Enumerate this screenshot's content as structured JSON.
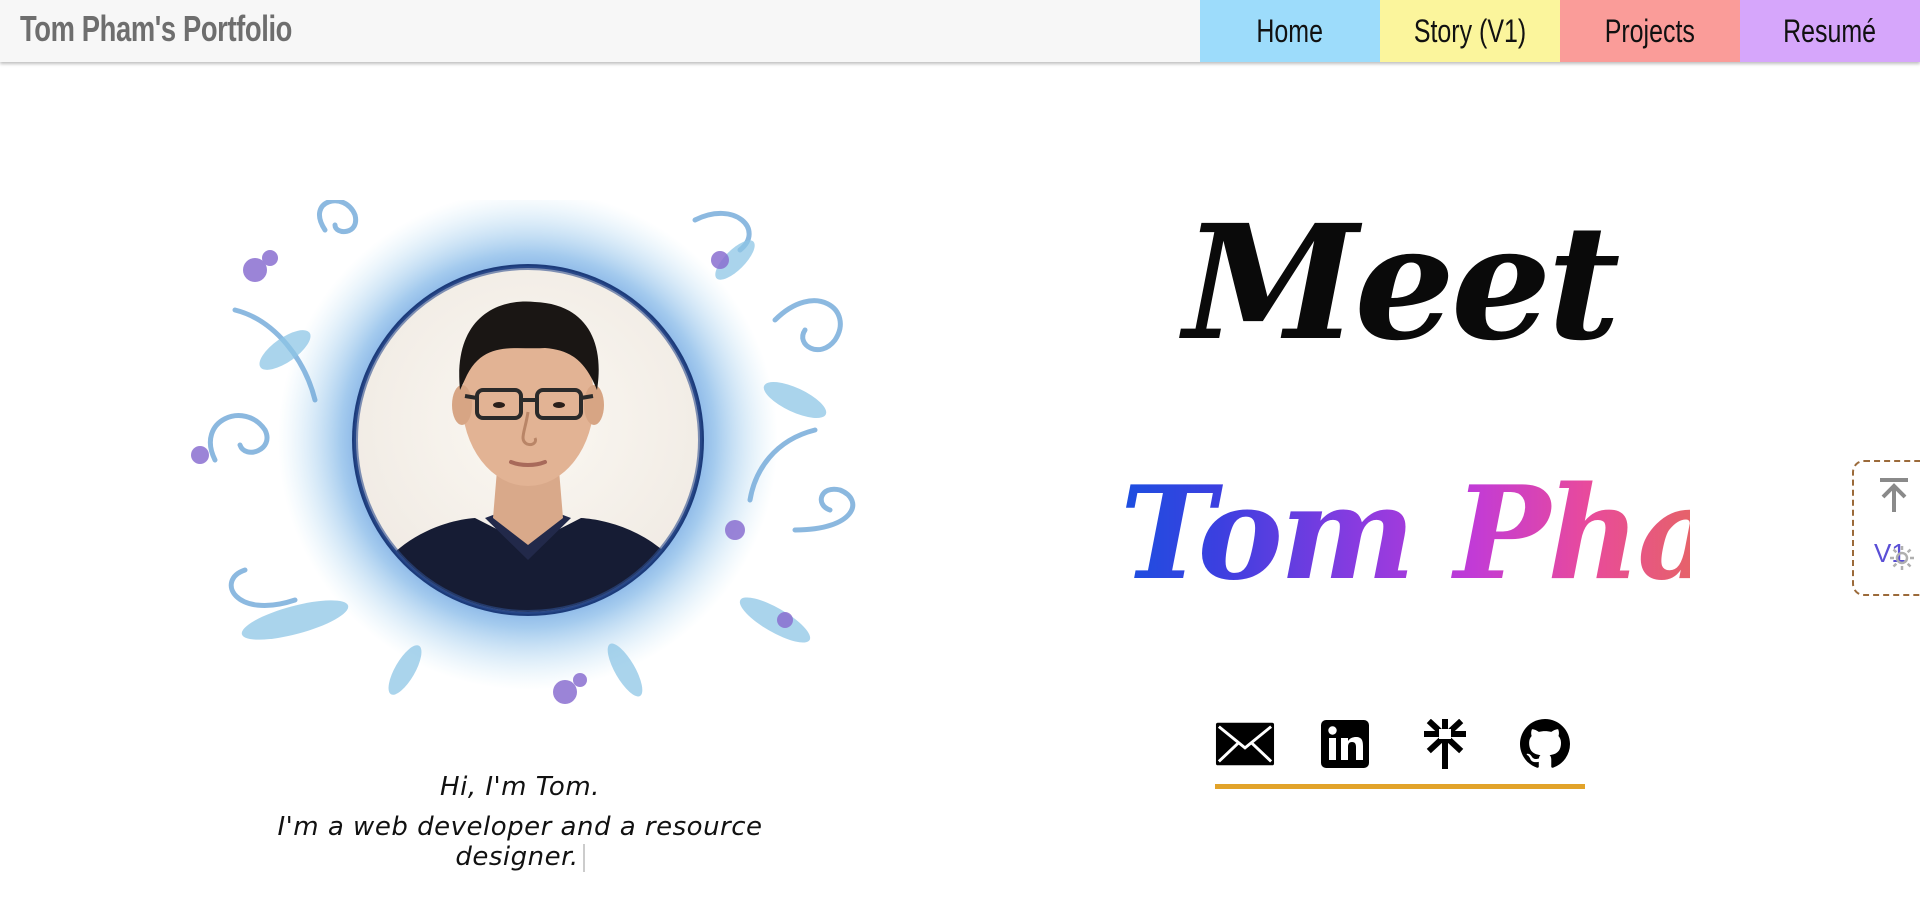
{
  "header": {
    "brand": "Tom Pham's Portfolio",
    "nav": [
      {
        "label": "Home",
        "color": "#9ddcfb"
      },
      {
        "label": "Story (V1)",
        "color": "#fbf59c"
      },
      {
        "label": "Projects",
        "color": "#fa9c99"
      },
      {
        "label": "Resumé",
        "color": "#d6a6fb"
      }
    ]
  },
  "hero": {
    "greeting": "Hi, I'm Tom.",
    "tagline": "I'm a web developer and a resource designer.",
    "meet": "Meet",
    "name": "Tom Pham"
  },
  "socials": [
    {
      "name": "mail-icon"
    },
    {
      "name": "linkedin-icon"
    },
    {
      "name": "linktree-icon"
    },
    {
      "name": "github-icon"
    }
  ],
  "widget": {
    "version_label": "V1",
    "icons": [
      "arrow-up-to-top-icon",
      "gear-icon"
    ]
  },
  "colors": {
    "underline": "#e2a32a",
    "name_gradient": [
      "#1b4fe0",
      "#8a3be0",
      "#e6626a"
    ]
  }
}
